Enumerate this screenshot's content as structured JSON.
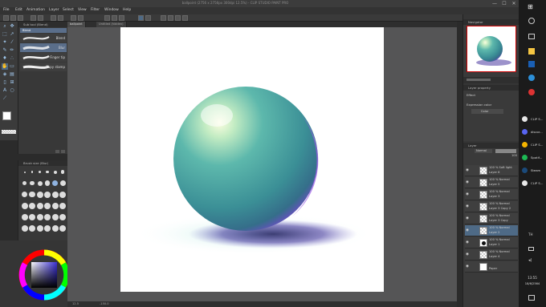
{
  "window": {
    "title": "ballpoint (2756 x 2756px 300dpi 12.5%) - CLIP STUDIO PAINT PRO",
    "minimize": "—",
    "maximize": "☐",
    "close": "✕"
  },
  "menu": [
    "File",
    "Edit",
    "Animation",
    "Layer",
    "Select",
    "View",
    "Filter",
    "Window",
    "Help"
  ],
  "tabs": [
    "ballpoint",
    "Untitled (hidden)"
  ],
  "subtool": {
    "header": "Sub tool (Blend)",
    "selected": "Blend",
    "items": [
      "Blend",
      "Blur",
      "Finger tip",
      "Copy stamp"
    ]
  },
  "brushsize": {
    "header": "Brush size (Blur)"
  },
  "status": {
    "zoom": "12.5",
    "coords": "-150.0"
  },
  "navigator": {
    "header": "Navigator"
  },
  "layer_property": {
    "header": "Layer property",
    "effect_label": "Effect",
    "expression_color_label": "Expression color",
    "expression_color_value": "Color"
  },
  "layer_panel": {
    "header": "Layer",
    "blend_mode": "Normal",
    "opacity": "100"
  },
  "layers": [
    {
      "mode": "100 % Soft light",
      "name": "Layer 6",
      "thumb": "checker",
      "selected": false
    },
    {
      "mode": "100 % Normal",
      "name": "Layer 5",
      "thumb": "checker",
      "selected": false
    },
    {
      "mode": "100 % Normal",
      "name": "Layer 3",
      "thumb": "checker",
      "selected": false
    },
    {
      "mode": "100 % Normal",
      "name": "Layer 3 Copy 2",
      "thumb": "checker",
      "selected": false
    },
    {
      "mode": "100 % Normal",
      "name": "Layer 3 Copy",
      "thumb": "checker",
      "selected": false
    },
    {
      "mode": "100 % Normal",
      "name": "Layer 2",
      "thumb": "checker",
      "selected": true
    },
    {
      "mode": "100 % Normal",
      "name": "Layer 1",
      "thumb": "black",
      "selected": false
    },
    {
      "mode": "100 % Normal",
      "name": "Layer 4",
      "thumb": "checker",
      "selected": false
    },
    {
      "mode": "",
      "name": "Paper",
      "thumb": "white",
      "selected": false
    }
  ],
  "taskbar": {
    "items": [
      {
        "label": "CLIP S...",
        "color": "#e8e8e8"
      },
      {
        "label": "discor...",
        "color": "#5865f2"
      },
      {
        "label": "CLIP S...",
        "color": "#f4b400"
      },
      {
        "label": "Spotif...",
        "color": "#1db954"
      },
      {
        "label": "Steam",
        "color": "#1b4a7a"
      },
      {
        "label": "CLIP S...",
        "color": "#e8e8e8"
      }
    ],
    "lang": "TH",
    "time": "13:55",
    "date": "18/6/2564"
  },
  "colors": {
    "accent": "#5a6e8a",
    "selected_layer": "#4e6a86",
    "sphere_main": "#3f9f9c",
    "sphere_edge": "#8a4fd8"
  }
}
